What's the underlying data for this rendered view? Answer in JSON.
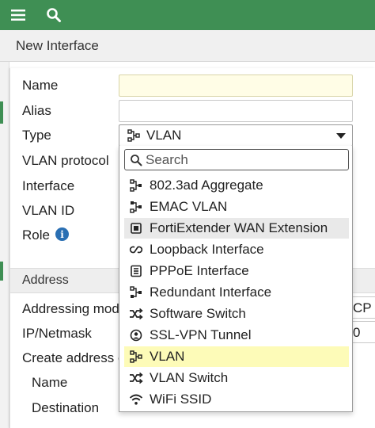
{
  "header": {
    "title": "New Interface"
  },
  "form": {
    "labels": {
      "name": "Name",
      "alias": "Alias",
      "type": "Type",
      "vlan_protocol": "VLAN protocol",
      "interface": "Interface",
      "vlan_id": "VLAN ID",
      "role": "Role",
      "addressing_mode": "Addressing mode",
      "ip_netmask": "IP/Netmask",
      "create_address_object": "Create address ob",
      "name_sub": "Name",
      "destination": "Destination"
    },
    "section_address": "Address",
    "clipped": {
      "addressing_mode_value": "CP",
      "ip_netmask_value": "0"
    }
  },
  "type_select": {
    "selected": "VLAN",
    "selected_icon": "vlan-icon"
  },
  "dropdown": {
    "search_placeholder": "Search",
    "hovered_index": 2,
    "selected_index": 8,
    "options": [
      {
        "label": "802.3ad Aggregate",
        "icon": "aggregate-icon"
      },
      {
        "label": "EMAC VLAN",
        "icon": "emac-vlan-icon"
      },
      {
        "label": "FortiExtender WAN Extension",
        "icon": "fortiextender-icon"
      },
      {
        "label": "Loopback Interface",
        "icon": "loopback-icon"
      },
      {
        "label": "PPPoE Interface",
        "icon": "pppoe-icon"
      },
      {
        "label": "Redundant Interface",
        "icon": "redundant-icon"
      },
      {
        "label": "Software Switch",
        "icon": "software-switch-icon"
      },
      {
        "label": "SSL-VPN Tunnel",
        "icon": "ssl-vpn-icon"
      },
      {
        "label": "VLAN",
        "icon": "vlan-icon"
      },
      {
        "label": "VLAN Switch",
        "icon": "vlan-switch-icon"
      },
      {
        "label": "WiFi SSID",
        "icon": "wifi-icon"
      }
    ]
  },
  "colors": {
    "topbar": "#3f8f54",
    "selected_option": "#fdfbb8",
    "hovered_option": "#e9e9e9",
    "name_field": "#fffde6"
  }
}
